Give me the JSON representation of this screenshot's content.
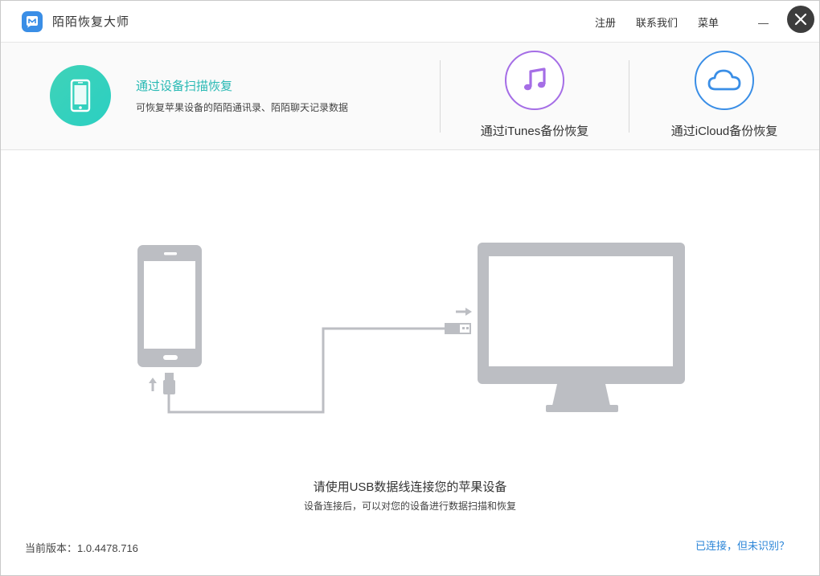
{
  "app": {
    "title": "陌陌恢复大师",
    "menu": [
      "注册",
      "联系我们",
      "菜单"
    ]
  },
  "modes": {
    "scan": {
      "title": "通过设备扫描恢复",
      "description": "可恢复苹果设备的陌陌通讯录、陌陌聊天记录数据",
      "icon": "phone-icon",
      "color": "#2fd0be"
    },
    "itunes": {
      "label": "通过iTunes备份恢复",
      "icon": "music-note-icon",
      "color": "#a56ee6"
    },
    "icloud": {
      "label": "通过iCloud备份恢复",
      "icon": "cloud-icon",
      "color": "#3a8ee6"
    }
  },
  "connect": {
    "title": "请使用USB数据线连接您的苹果设备",
    "subtitle": "设备连接后，可以对您的设备进行数据扫描和恢复"
  },
  "footer": {
    "version": "当前版本：1.0.4478.716",
    "help_link": "已连接，但未识别？"
  },
  "colors": {
    "illustration": "#bcbec3",
    "link": "#2c86d8",
    "accent": "#28b9b4"
  }
}
